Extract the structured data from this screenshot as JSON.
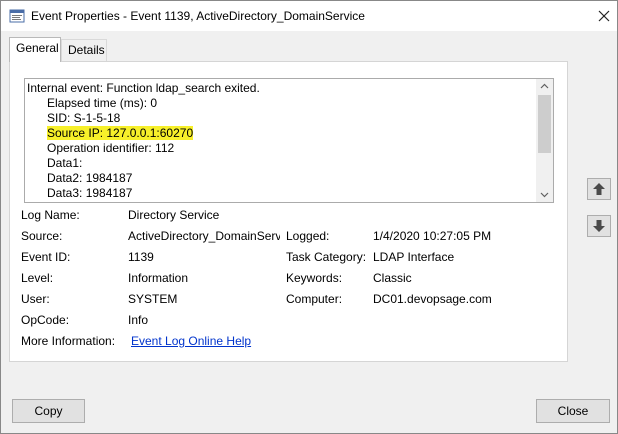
{
  "window": {
    "title": "Event Properties - Event 1139, ActiveDirectory_DomainService",
    "close_glyph": "✕"
  },
  "tabs": [
    {
      "label": "General",
      "active": true
    },
    {
      "label": "Details",
      "active": false
    }
  ],
  "description": {
    "line0": "Internal event: Function ldap_search exited.",
    "line1": "Elapsed time (ms): 0",
    "line2": "SID: S-1-5-18",
    "line3_label": "Source IP:",
    "line3_value": " 127.0.0.1:60270",
    "line4": "Operation identifier: 112",
    "line5": "Data1:",
    "line6": "Data2: 1984187",
    "line7": "Data3: 1984187",
    "highlight_color": "#f7f02a"
  },
  "fields": {
    "log_name_label": "Log Name:",
    "log_name_value": "Directory Service",
    "source_label": "Source:",
    "source_value": "ActiveDirectory_DomainServ",
    "logged_label": "Logged:",
    "logged_value": "1/4/2020 10:27:05 PM",
    "event_id_label": "Event ID:",
    "event_id_value": "1139",
    "task_category_label": "Task Category:",
    "task_category_value": "LDAP Interface",
    "level_label": "Level:",
    "level_value": "Information",
    "keywords_label": "Keywords:",
    "keywords_value": "Classic",
    "user_label": "User:",
    "user_value": "SYSTEM",
    "computer_label": "Computer:",
    "computer_value": "DC01.devopsage.com",
    "opcode_label": "OpCode:",
    "opcode_value": "Info",
    "more_info_label": "More Information:",
    "more_info_link": "Event Log Online Help"
  },
  "buttons": {
    "copy": "Copy",
    "close": "Close"
  },
  "icons": {
    "app": "event-viewer-icon",
    "nav_up": "arrow-up-icon",
    "nav_down": "arrow-down-icon"
  },
  "colors": {
    "link": "#0033cc",
    "highlight": "#f7f02a"
  }
}
